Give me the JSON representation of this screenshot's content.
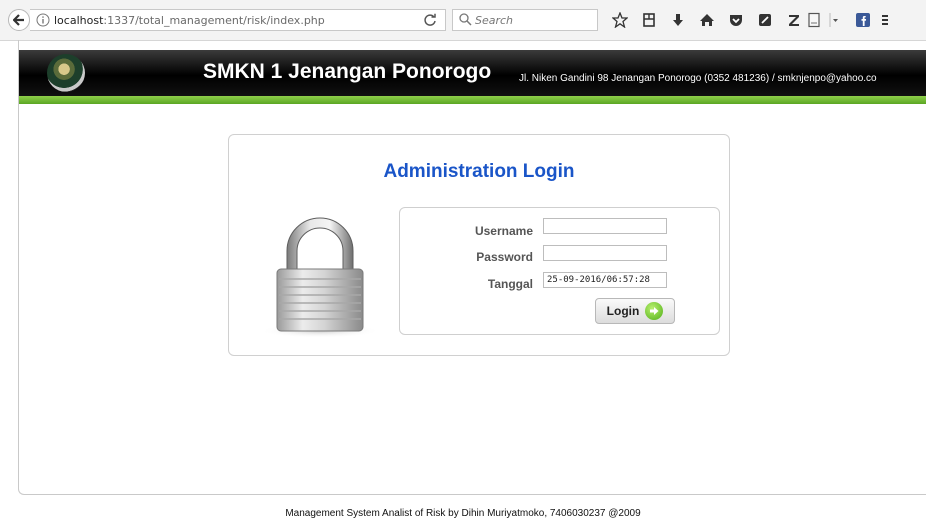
{
  "browser": {
    "url_host": "localhost",
    "url_path": ":1337/total_management/risk/index.php",
    "search_placeholder": "Search",
    "toolbar_icons": [
      "bookmark-star-icon",
      "reader-icon",
      "download-icon",
      "home-icon",
      "pocket-icon",
      "extension-icon",
      "zotero-icon",
      "page-icon",
      "dropdown-icon",
      "facebook-icon",
      "menu-icon"
    ]
  },
  "header": {
    "title": "SMKN 1 Jenangan Ponorogo",
    "address": "Jl. Niken Gandini 98 Jenangan Ponorogo (0352 481236) / smknjenpo@yahoo.co"
  },
  "login": {
    "title": "Administration Login",
    "username_label": "Username",
    "username_value": "",
    "password_label": "Password",
    "password_value": "",
    "tanggal_label": "Tanggal",
    "tanggal_value": "25-09-2016/06:57:28",
    "button_label": "Login"
  },
  "footer": {
    "text": "Management System Analist of Risk by Dihin Muriyatmoko, 7406030237 @2009"
  },
  "colors": {
    "title_blue": "#1a55c8",
    "header_black": "#000000",
    "accent_green": "#6cbb2e"
  }
}
